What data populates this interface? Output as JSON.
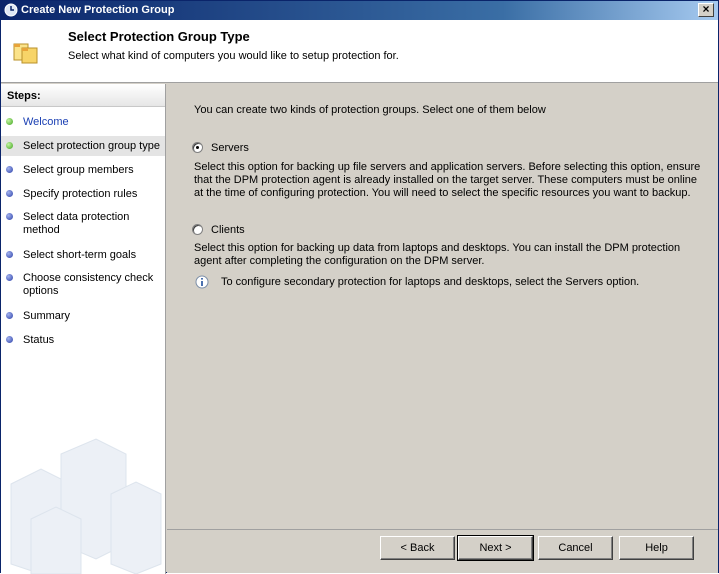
{
  "window": {
    "title": "Create New Protection Group"
  },
  "header": {
    "title": "Select Protection Group Type",
    "subtitle": "Select what kind of computers you would like to setup protection for."
  },
  "sidebar": {
    "heading": "Steps:",
    "items": [
      {
        "label": "Welcome",
        "state": "done"
      },
      {
        "label": "Select protection group type",
        "state": "current"
      },
      {
        "label": "Select group members",
        "state": "pending"
      },
      {
        "label": "Specify protection rules",
        "state": "pending"
      },
      {
        "label": "Select data protection method",
        "state": "pending"
      },
      {
        "label": "Select short-term goals",
        "state": "pending"
      },
      {
        "label": "Choose consistency check options",
        "state": "pending"
      },
      {
        "label": "Summary",
        "state": "pending"
      },
      {
        "label": "Status",
        "state": "pending"
      }
    ]
  },
  "main": {
    "intro": "You can create two kinds of protection groups. Select one of them below",
    "options": [
      {
        "label": "Servers",
        "selected": true,
        "description": "Select this option for backing up file servers and application servers. Before selecting this option, ensure that the DPM protection agent is already installed on the target server. These computers must be online at the time of configuring protection. You will need to select the specific resources you want to backup."
      },
      {
        "label": "Clients",
        "selected": false,
        "description": "Select this option for backing up data from laptops and desktops. You can install the DPM protection agent after completing the configuration on the DPM server."
      }
    ],
    "info_note": "To configure secondary protection for laptops and desktops, select the Servers option."
  },
  "footer": {
    "back_label": "< Back",
    "next_label": "Next >",
    "cancel_label": "Cancel",
    "help_label": "Help"
  },
  "colors": {
    "title_bar": "#0a246a",
    "step_done": "#3fa41c",
    "step_pending": "#2b3fa8",
    "link": "#1a3fb3",
    "dialog_bg": "#d4d0c8"
  }
}
